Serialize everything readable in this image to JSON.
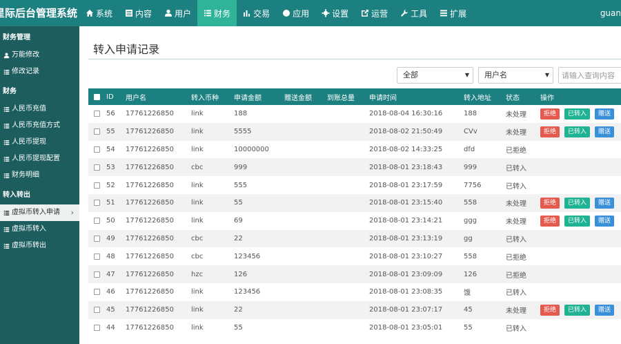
{
  "brand": "星际后台管理系统",
  "nav": [
    {
      "label": "系统",
      "icon": "home-icon"
    },
    {
      "label": "内容",
      "icon": "list-box-icon"
    },
    {
      "label": "用户",
      "icon": "user-icon"
    },
    {
      "label": "财务",
      "icon": "list-icon",
      "active": true
    },
    {
      "label": "交易",
      "icon": "bar-chart-icon"
    },
    {
      "label": "应用",
      "icon": "globe-icon"
    },
    {
      "label": "设置",
      "icon": "gear-icon"
    },
    {
      "label": "运营",
      "icon": "external-icon"
    },
    {
      "label": "工具",
      "icon": "wrench-icon"
    },
    {
      "label": "扩展",
      "icon": "layers-icon"
    }
  ],
  "user": "guan",
  "sidebar": [
    {
      "type": "group",
      "label": "财务管理"
    },
    {
      "type": "item",
      "label": "万能修改",
      "icon": "user-icon"
    },
    {
      "type": "item",
      "label": "修改记录",
      "icon": "list-icon"
    },
    {
      "type": "group",
      "label": "财务"
    },
    {
      "type": "item",
      "label": "人民币充值",
      "icon": "list-icon"
    },
    {
      "type": "item",
      "label": "人民币充值方式",
      "icon": "list-icon"
    },
    {
      "type": "item",
      "label": "人民币提现",
      "icon": "list-icon"
    },
    {
      "type": "item",
      "label": "人民币提现配置",
      "icon": "list-icon"
    },
    {
      "type": "item",
      "label": "财务明细",
      "icon": "list-icon"
    },
    {
      "type": "group",
      "label": "转入转出"
    },
    {
      "type": "item",
      "label": "虚拟币转入申请",
      "icon": "list-icon",
      "active": true
    },
    {
      "type": "item",
      "label": "虚拟币转入",
      "icon": "list-icon"
    },
    {
      "type": "item",
      "label": "虚拟币转出",
      "icon": "list-icon"
    }
  ],
  "page_title": "转入申请记录",
  "filters": {
    "status_select": "全部",
    "field_select": "用户名",
    "search_placeholder": "请输入查询内容"
  },
  "columns": [
    "ID",
    "用户名",
    "转入币种",
    "申请金额",
    "赠送金额",
    "到账总量",
    "申请时间",
    "转入地址",
    "状态",
    "操作"
  ],
  "actions": {
    "reject": "拒绝",
    "transferred": "已转入",
    "gift": "赠送"
  },
  "rows": [
    {
      "id": "56",
      "user": "17761226850",
      "coin": "link",
      "amount": "188",
      "gift": "",
      "total": "",
      "time": "2018-08-04 16:30:16",
      "address": "188",
      "status": "未处理",
      "actions": true
    },
    {
      "id": "55",
      "user": "17761226850",
      "coin": "link",
      "amount": "5555",
      "gift": "",
      "total": "",
      "time": "2018-08-02 21:50:49",
      "address": "CVv",
      "status": "未处理",
      "actions": true
    },
    {
      "id": "54",
      "user": "17761226850",
      "coin": "link",
      "amount": "10000000",
      "gift": "",
      "total": "",
      "time": "2018-08-02 14:33:25",
      "address": "dfd",
      "status": "已拒绝",
      "actions": false
    },
    {
      "id": "53",
      "user": "17761226850",
      "coin": "cbc",
      "amount": "999",
      "gift": "",
      "total": "",
      "time": "2018-08-01 23:18:43",
      "address": "999",
      "status": "已转入",
      "actions": false
    },
    {
      "id": "52",
      "user": "17761226850",
      "coin": "link",
      "amount": "555",
      "gift": "",
      "total": "",
      "time": "2018-08-01 23:17:59",
      "address": "7756",
      "status": "已转入",
      "actions": false
    },
    {
      "id": "51",
      "user": "17761226850",
      "coin": "link",
      "amount": "55",
      "gift": "",
      "total": "",
      "time": "2018-08-01 23:15:40",
      "address": "558",
      "status": "未处理",
      "actions": true
    },
    {
      "id": "50",
      "user": "17761226850",
      "coin": "link",
      "amount": "69",
      "gift": "",
      "total": "",
      "time": "2018-08-01 23:14:21",
      "address": "ggg",
      "status": "未处理",
      "actions": true
    },
    {
      "id": "49",
      "user": "17761226850",
      "coin": "cbc",
      "amount": "22",
      "gift": "",
      "total": "",
      "time": "2018-08-01 23:13:19",
      "address": "gg",
      "status": "已转入",
      "actions": false
    },
    {
      "id": "48",
      "user": "17761226850",
      "coin": "cbc",
      "amount": "123456",
      "gift": "",
      "total": "",
      "time": "2018-08-01 23:10:27",
      "address": "558",
      "status": "已拒绝",
      "actions": false
    },
    {
      "id": "47",
      "user": "17761226850",
      "coin": "hzc",
      "amount": "126",
      "gift": "",
      "total": "",
      "time": "2018-08-01 23:09:09",
      "address": "126",
      "status": "已拒绝",
      "actions": false
    },
    {
      "id": "46",
      "user": "17761226850",
      "coin": "link",
      "amount": "123456",
      "gift": "",
      "total": "",
      "time": "2018-08-01 23:08:35",
      "address": "饿",
      "status": "已转入",
      "actions": false
    },
    {
      "id": "45",
      "user": "17761226850",
      "coin": "link",
      "amount": "22",
      "gift": "",
      "total": "",
      "time": "2018-08-01 23:07:17",
      "address": "45",
      "status": "未处理",
      "actions": true
    },
    {
      "id": "44",
      "user": "17761226850",
      "coin": "link",
      "amount": "55",
      "gift": "",
      "total": "",
      "time": "2018-08-01 23:05:01",
      "address": "55",
      "status": "已转入",
      "actions": false
    }
  ]
}
